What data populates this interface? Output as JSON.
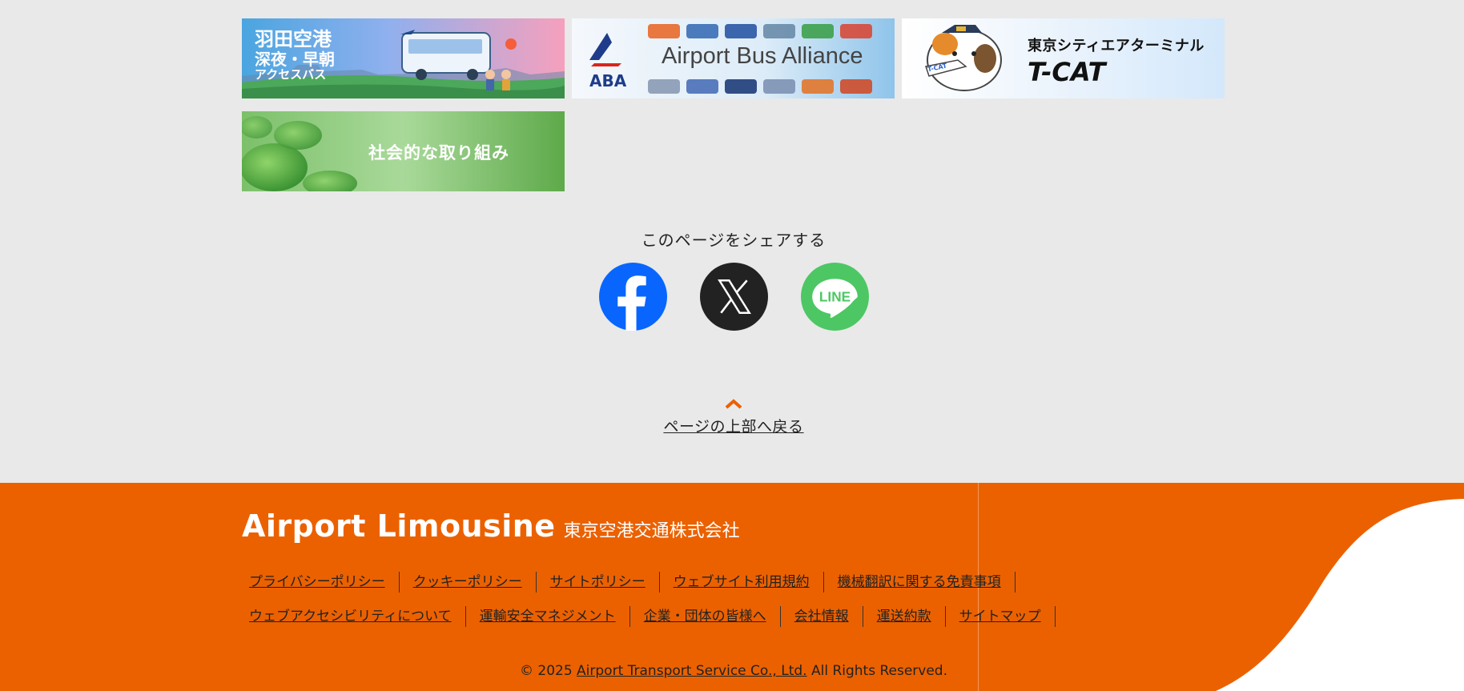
{
  "banners": [
    {
      "lines": [
        "羽田空港",
        "深夜・早朝",
        "アクセスバス"
      ],
      "alt": "羽田空港 深夜・早朝アクセスバス"
    },
    {
      "logo_text": "ABA",
      "title": "Airport Bus Alliance"
    },
    {
      "title_jp": "東京シティエアターミナル",
      "title_en": "T-CAT",
      "mascot_tag": "T-CAT"
    },
    {
      "title": "社会的な取り組み"
    }
  ],
  "share": {
    "title": "このページをシェアする",
    "icons": [
      {
        "name": "facebook",
        "color": "#0866ff"
      },
      {
        "name": "x",
        "color": "#222222"
      },
      {
        "name": "line",
        "label": "LINE",
        "color": "#4cc764"
      }
    ]
  },
  "to_top": {
    "label": "ページの上部へ戻る",
    "accent": "#eb6100"
  },
  "footer": {
    "brand": "Airport Limousine",
    "company": "東京空港交通株式会社",
    "links_row1": [
      "プライバシーポリシー",
      "クッキーポリシー",
      "サイトポリシー",
      "ウェブサイト利用規約",
      "機械翻訳に関する免責事項"
    ],
    "links_row2": [
      "ウェブアクセシビリティについて",
      "運輸安全マネジメント",
      "企業・団体の皆様へ",
      "会社情報",
      "運送約款",
      "サイトマップ"
    ],
    "copyright_prefix": "© 2025",
    "copyright_link": "Airport Transport Service Co., Ltd.",
    "copyright_suffix": "All Rights Reserved.",
    "bg_color": "#eb6100"
  }
}
